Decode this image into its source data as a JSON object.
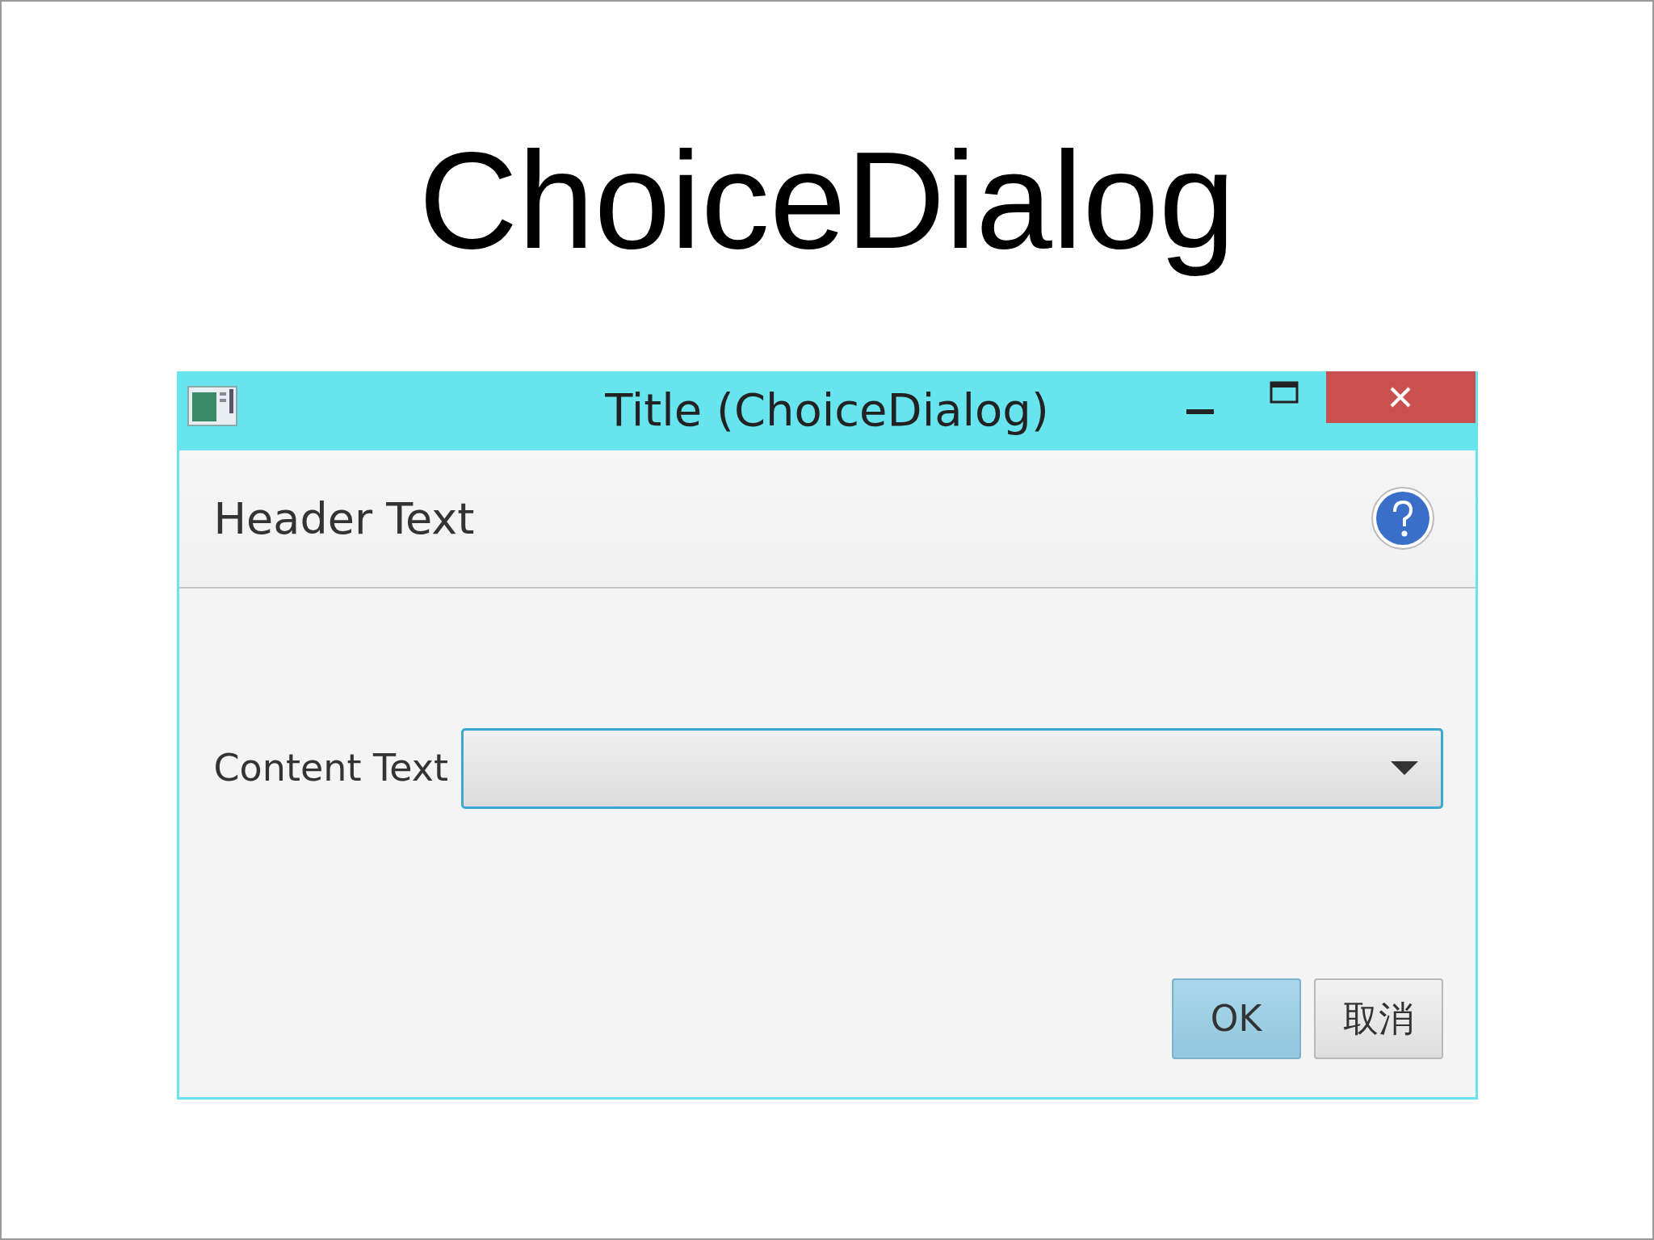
{
  "slide_title": "ChoiceDialog",
  "window": {
    "title": "Title (ChoiceDialog)"
  },
  "header": {
    "text": "Header Text"
  },
  "content": {
    "label": "Content Text"
  },
  "buttons": [
    {
      "label": "OK",
      "default": true
    },
    {
      "label": "取消",
      "default": false
    }
  ]
}
